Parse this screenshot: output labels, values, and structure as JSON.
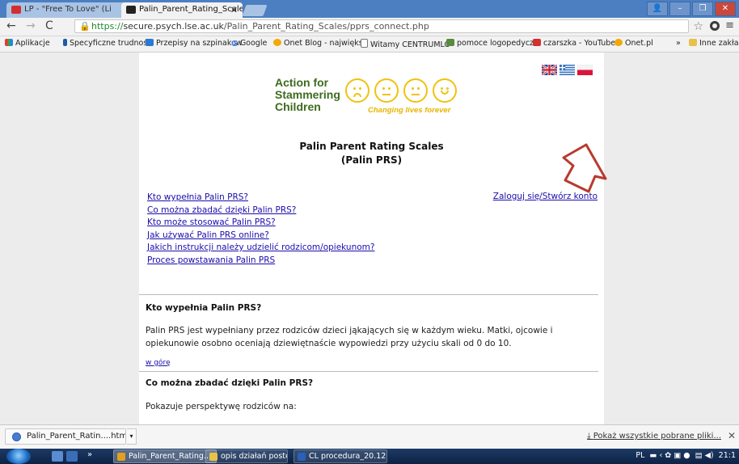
{
  "browser": {
    "tabs": [
      {
        "title": "LP - \"Free To Love\" (Li",
        "favicon": "youtube-icon",
        "color": "#d32f2f"
      },
      {
        "title": "Palin_Parent_Rating_Scale",
        "favicon": "lse-icon",
        "color": "#222222"
      }
    ],
    "url_scheme": "https://",
    "url_domain": "secure.psych.lse.ac.uk",
    "url_path": "/Palin_Parent_Rating_Scales/pprs_connect.php",
    "bookmarks": [
      {
        "label": "Aplikacje",
        "icon": "apps-icon"
      },
      {
        "label": "Specyficzne trudności",
        "icon": "bookmark-icon"
      },
      {
        "label": "Przepisy na szpinakow",
        "icon": "trello-icon"
      },
      {
        "label": "Google",
        "icon": "google-icon"
      },
      {
        "label": "Onet Blog - największ",
        "icon": "onet-icon"
      },
      {
        "label": "Witamy CENTRUMLO",
        "icon": "page-icon"
      },
      {
        "label": "pomoce logopedyczn",
        "icon": "image-icon"
      },
      {
        "label": "czarszka - YouTube",
        "icon": "youtube-icon"
      },
      {
        "label": "Onet.pl",
        "icon": "onet-icon"
      }
    ],
    "bookmarks_more": "»",
    "other_bookmarks": "Inne zakładki"
  },
  "page": {
    "logo": {
      "line1": "Action for",
      "line2": "Stammering",
      "line3": "Children",
      "tagline": "Changing lives forever"
    },
    "title_line1": "Palin Parent Rating Scales",
    "title_line2": "(Palin PRS)",
    "toc": [
      "Kto wypełnia Palin PRS?",
      "Co można zbadać dzięki Palin PRS?",
      "Kto może stosować Palin PRS?",
      "Jak używać Palin PRS online?",
      "Jakich instrukcji należy udzielić rodzicom/opiekunom?",
      "Proces powstawania Palin PRS"
    ],
    "login_link": "Zaloguj się/Stwórz konto",
    "sections": [
      {
        "heading": "Kto wypełnia Palin PRS?",
        "body": "Palin PRS jest wypełniany przez rodziców dzieci jąkających się w każdym wieku. Matki, ojcowie i opiekunowie osobno oceniają dziewiętnaście wypowiedzi przy użyciu skali od 0 do 10.",
        "up_link": "w górę"
      },
      {
        "heading": "Co można zbadać dzięki Palin PRS?",
        "body": "Pokazuje perspektywę rodziców na:"
      }
    ]
  },
  "downloads": {
    "filename": "Palin_Parent_Ratin....html",
    "show_all": "Pokaż wszystkie pobrane pliki...",
    "show_all_icon": "download-icon"
  },
  "taskbar": {
    "tasks": [
      {
        "label": "Palin_Parent_Rating...",
        "icon": "chrome-icon",
        "color": "#e0a020"
      },
      {
        "label": "opis działań postęp...",
        "icon": "folder-icon",
        "color": "#e8c14a"
      },
      {
        "label": "CL procedura_20.12....",
        "icon": "word-icon",
        "color": "#2b5fb8"
      }
    ],
    "language": "PL",
    "clock": "21:1"
  }
}
